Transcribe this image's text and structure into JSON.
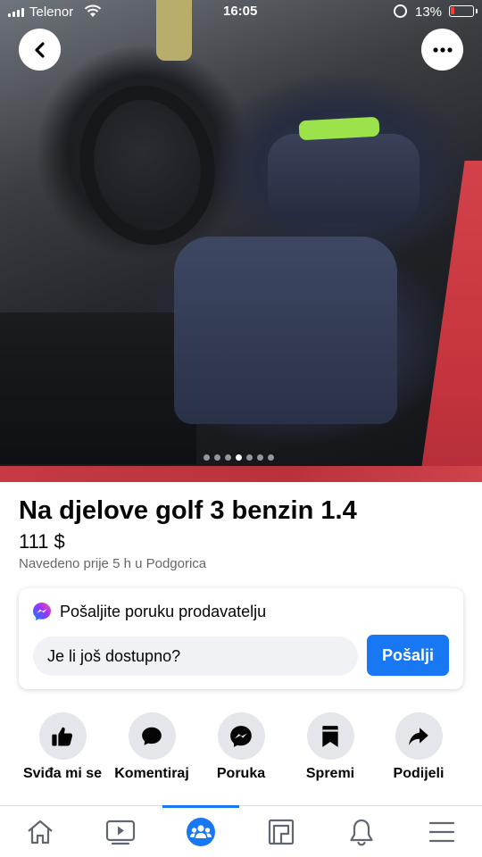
{
  "status_bar": {
    "carrier": "Telenor",
    "time": "16:05",
    "battery_percent": "13%"
  },
  "photo": {
    "carousel_total": 7,
    "carousel_active_index": 3
  },
  "listing": {
    "title": "Na djelove golf 3 benzin 1.4",
    "price": "111 $",
    "meta": "Navedeno prije 5 h u Podgorica"
  },
  "message_card": {
    "header": "Pošaljite poruku prodavatelju",
    "input_value": "Je li još dostupno?",
    "send_label": "Pošalji"
  },
  "actions": [
    {
      "label": "Sviđa mi se",
      "icon": "thumbs-up-icon"
    },
    {
      "label": "Komentiraj",
      "icon": "comment-icon"
    },
    {
      "label": "Poruka",
      "icon": "messenger-icon"
    },
    {
      "label": "Spremi",
      "icon": "bookmark-icon"
    },
    {
      "label": "Podijeli",
      "icon": "share-icon"
    }
  ],
  "bottom_nav": [
    {
      "icon": "home-icon"
    },
    {
      "icon": "watch-icon"
    },
    {
      "icon": "groups-icon",
      "active": true
    },
    {
      "icon": "marketplace-icon"
    },
    {
      "icon": "bell-icon"
    },
    {
      "icon": "menu-icon"
    }
  ],
  "colors": {
    "accent": "#1877f2",
    "battery_low": "#ff3b30",
    "action_circle": "#e4e6eb",
    "secondary_text": "#65676b"
  }
}
